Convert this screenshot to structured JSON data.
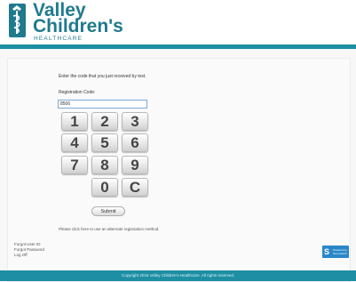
{
  "brand": {
    "line1": "Valley",
    "line2": "Children's",
    "line3": "HEALTHCARE"
  },
  "form": {
    "prompt": "Enter the code that you just received by text.",
    "registration_label": "Registration Code:",
    "registration_value": "8506",
    "submit_label": "Submit",
    "alternate_link": "Please click here to use an alternate registration method."
  },
  "keypad": {
    "keys": [
      "1",
      "2",
      "3",
      "4",
      "5",
      "6",
      "7",
      "8",
      "9",
      "0",
      "C"
    ]
  },
  "footer": {
    "forgot_user_id": "Forgot User ID",
    "forgot_password": "Forgot Password",
    "log_off": "Log Off",
    "badge_line1": "Powered by",
    "badge_line2": "SecureAuth",
    "copyright": "Copyright 2016 Valley Children's Healthcare. All rights reserved."
  },
  "colors": {
    "brand_teal": "#1f7a8e",
    "bar_teal": "#1d8ea3",
    "badge_blue": "#2a86c8"
  },
  "icons": {
    "logo": "valley-children-logo-icon",
    "badge": "secureauth-icon"
  }
}
